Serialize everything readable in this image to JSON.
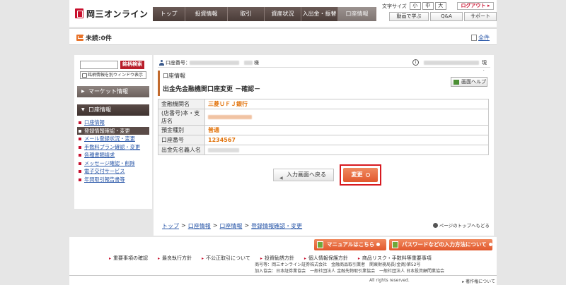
{
  "header": {
    "logo_text": "岡三オンライン",
    "nav": [
      {
        "label": "トップ",
        "width": 46
      },
      {
        "label": "投資情報",
        "width": 60
      },
      {
        "label": "取引",
        "width": 52
      },
      {
        "label": "資産状況",
        "width": 52
      },
      {
        "label": "入出金・振替",
        "width": 52
      },
      {
        "label": "口座情報",
        "width": 54
      }
    ],
    "font_size_label": "文字サイズ",
    "font_sizes": [
      "小",
      "中",
      "大"
    ],
    "logout_label": "ログアウト",
    "sub_buttons": [
      "動画で学ぶ",
      "Q&A",
      "サポート"
    ]
  },
  "unread": {
    "label": "未読:0件",
    "all_link": "全件"
  },
  "sidebar": {
    "search_button": "銘柄検索",
    "stock_window_label": "銘柄情報を別ウィンドウ表示",
    "market_info": "マーケット情報",
    "account_info": "口座情報",
    "items": [
      {
        "label": "口座情報",
        "current": false
      },
      {
        "label": "登録情報確認・変更",
        "current": true
      },
      {
        "label": "メール登録状況・変更",
        "current": false
      },
      {
        "label": "手数料プラン確認・変更",
        "current": false
      },
      {
        "label": "各種書類請求",
        "current": false
      },
      {
        "label": "メッセージ確認・削除",
        "current": false
      },
      {
        "label": "電子交付サービス",
        "current": false
      },
      {
        "label": "年間取引報告書等",
        "current": false
      }
    ]
  },
  "main": {
    "account_label": "口座番号：",
    "sama": "様",
    "info_icon": "i",
    "now_label": "現在",
    "title_sub": "口座情報",
    "title_main": "出金先金融機関口座変更 －確認－",
    "help_button": "画面ヘルプ",
    "rows": [
      {
        "label": "金融機関名",
        "value": "三菱ＵＦＪ銀行",
        "masked": false
      },
      {
        "label": "(店番号)本・支店名",
        "value": "",
        "masked": true
      },
      {
        "label": "預金種別",
        "value": "普通",
        "masked": false
      },
      {
        "label": "口座番号",
        "value": "1234567",
        "masked": false
      },
      {
        "label": "出金先名義人名",
        "value": "",
        "masked": true
      }
    ],
    "back_button": "入力画面へ戻る",
    "change_button": "変更",
    "breadcrumb": [
      "トップ",
      "口座情報",
      "口座情報",
      "登録情報確認・変更"
    ],
    "breadcrumb_sep": ">",
    "page_top": "ページのトップへもどる"
  },
  "footer": {
    "manual_button": "マニュアルはこちら",
    "password_button": "パスワードなどの入力方法について",
    "links": [
      "重要事項の確認",
      "最良執行方針",
      "不公正取引について",
      "投資勧誘方針",
      "個人情報保護方針",
      "商品リスク・手数料等重要事項"
    ],
    "registration_1": "商号等：岡三オンライン証券株式会社　金融商品取引業者　関東財務局長(金商)第52号",
    "registration_2": "加入協会：日本証券業協会　一般社団法人 金融先物取引業協会　一般社団法人 日本投資顧問業協会",
    "copyright": "All rights reserved.",
    "copyright_link": "著作権について"
  }
}
